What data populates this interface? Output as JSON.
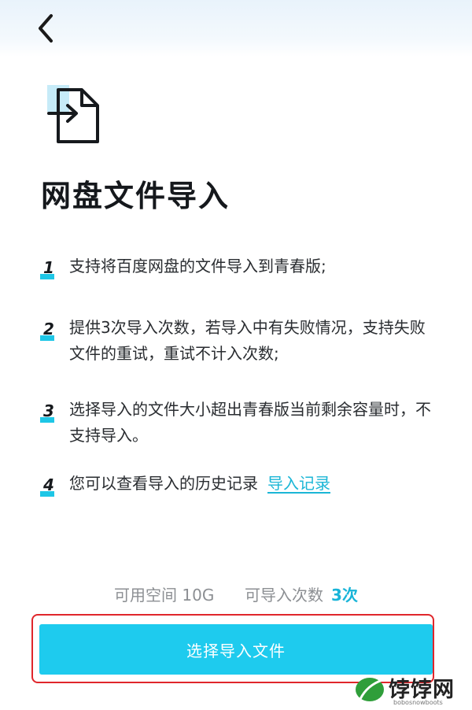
{
  "header": {
    "back_icon": "chevron-left-icon"
  },
  "hero": {
    "icon": "file-import-icon",
    "title": "网盘文件导入"
  },
  "rules": [
    {
      "num": "1",
      "text": "支持将百度网盘的文件导入到青春版;"
    },
    {
      "num": "2",
      "text": "提供3次导入次数，若导入中有失败情况，支持失败文件的重试，重试不计入次数;"
    },
    {
      "num": "3",
      "text": "选择导入的文件大小超出青春版当前剩余容量时，不支持导入。"
    },
    {
      "num": "4",
      "text": "您可以查看导入的历史记录",
      "link": "导入记录"
    }
  ],
  "quota": {
    "space_label": "可用空间",
    "space_value": "10G",
    "count_label": "可导入次数",
    "count_value": "3次"
  },
  "action": {
    "select_button": "选择导入文件"
  },
  "watermark": {
    "text": "饽饽网",
    "sub": "bobosnowboots"
  },
  "colors": {
    "accent": "#1ecbee",
    "link": "#1bb6d6",
    "highlight_border": "#e0262b"
  }
}
